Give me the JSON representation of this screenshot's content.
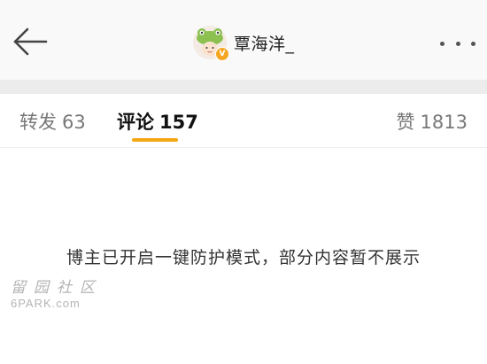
{
  "header": {
    "back_icon": "arrow-left-icon",
    "username": "覃海洋_",
    "avatar_icon": "frog-hat-avatar",
    "verified_icon": "verified-badge-icon",
    "verified_mark": "V",
    "more_icon": "more-dots-icon"
  },
  "tabs": [
    {
      "label": "转发",
      "count": "63",
      "active": false
    },
    {
      "label": "评论",
      "count": "157",
      "active": true
    },
    {
      "label": "赞",
      "count": "1813",
      "active": false
    }
  ],
  "colors": {
    "accent": "#f3a712",
    "verified": "#f5a623"
  },
  "notice": "博主已开启一键防护模式，部分内容暂不展示",
  "watermark": {
    "chars": "留园社区",
    "site": "6PARK.com"
  }
}
